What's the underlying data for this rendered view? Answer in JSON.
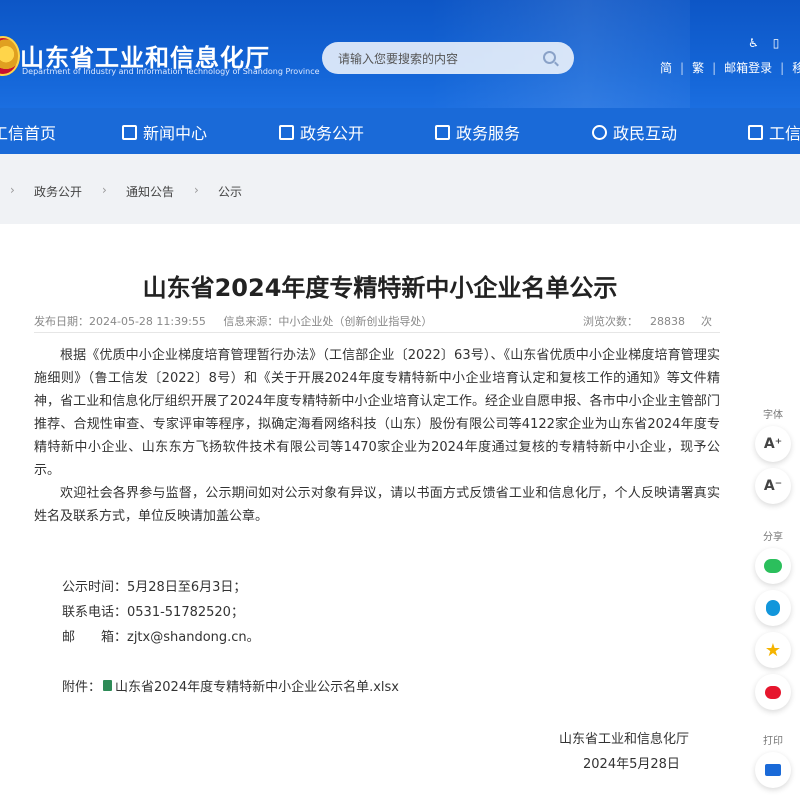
{
  "header": {
    "title": "山东省工业和信息化厅",
    "subtitle": "Department of Industry and Information Technology of Shandong Province",
    "search_placeholder": "请输入您要搜索的内容",
    "links": [
      "简",
      "繁",
      "邮箱登录",
      "移"
    ]
  },
  "nav": {
    "items": [
      {
        "label": "工信首页"
      },
      {
        "label": "新闻中心"
      },
      {
        "label": "政务公开"
      },
      {
        "label": "政务服务"
      },
      {
        "label": "政民互动"
      },
      {
        "label": "工信"
      }
    ]
  },
  "breadcrumb": [
    "政务公开",
    "通知公告",
    "公示"
  ],
  "article": {
    "title": "山东省2024年度专精特新中小企业名单公示",
    "publish_label": "发布日期：2024-05-28 11:39:55",
    "source_label": "信息来源：中小企业处（创新创业指导处）",
    "views_label": "浏览次数：",
    "views_count": "28838",
    "views_unit": "次",
    "paragraph1": "根据《优质中小企业梯度培育管理暂行办法》（工信部企业〔2022〕63号）、《山东省优质中小企业梯度培育管理实施细则》（鲁工信发〔2022〕8号）和《关于开展2024年度专精特新中小企业培育认定和复核工作的通知》等文件精神，省工业和信息化厅组织开展了2024年度专精特新中小企业培育认定工作。经企业自愿申报、各市中小企业主管部门推荐、合规性审查、专家评审等程序，拟确定海看网络科技（山东）股份有限公司等4122家企业为山东省2024年度专精特新中小企业、山东东方飞扬软件技术有限公司等1470家企业为2024年度通过复核的专精特新中小企业，现予公示。",
    "paragraph2": "欢迎社会各界参与监督，公示期间如对公示对象有异议，请以书面方式反馈省工业和信息化厅，个人反映请署真实姓名及联系方式，单位反映请加盖公章。",
    "period": "公示时间：5月28日至6月3日；",
    "phone": "联系电话：0531-51782520；",
    "email": "邮　　箱：zjtx@shandong.cn。",
    "attachment_label": "附件：",
    "attachment_file": "山东省2024年度专精特新中小企业公示名单.xlsx",
    "signature_org": "山东省工业和信息化厅",
    "signature_date": "2024年5月28日"
  },
  "side_tools": {
    "font_label": "字体",
    "font_increase": "A⁺",
    "font_decrease": "A⁻",
    "share_label": "分享",
    "print_label": "打印"
  },
  "colors": {
    "header_blue": "#1466d8",
    "wechat": "#2bbf5c",
    "qq": "#1296db",
    "qzone": "#f5b400",
    "weibo": "#e6162d"
  }
}
